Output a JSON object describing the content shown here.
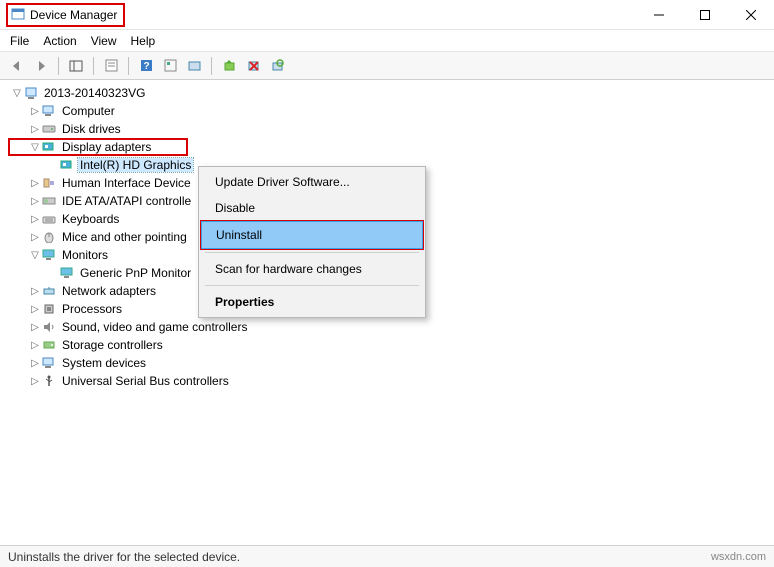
{
  "window": {
    "title": "Device Manager"
  },
  "menu": {
    "file": "File",
    "action": "Action",
    "view": "View",
    "help": "Help"
  },
  "tree": {
    "root": "2013-20140323VG",
    "items": [
      {
        "label": "Computer",
        "twisty": "▷"
      },
      {
        "label": "Disk drives",
        "twisty": "▷"
      },
      {
        "label": "Display adapters",
        "twisty": "▽",
        "highlight": true
      },
      {
        "label": "Intel(R) HD Graphics",
        "child": true,
        "selected": true
      },
      {
        "label": "Human Interface Device",
        "twisty": "▷",
        "truncated": true
      },
      {
        "label": "IDE ATA/ATAPI controlle",
        "twisty": "▷",
        "truncated": true
      },
      {
        "label": "Keyboards",
        "twisty": "▷"
      },
      {
        "label": "Mice and other pointing",
        "twisty": "▷",
        "truncated": true
      },
      {
        "label": "Monitors",
        "twisty": "▽"
      },
      {
        "label": "Generic PnP Monitor",
        "child": true
      },
      {
        "label": "Network adapters",
        "twisty": "▷"
      },
      {
        "label": "Processors",
        "twisty": "▷"
      },
      {
        "label": "Sound, video and game controllers",
        "twisty": "▷"
      },
      {
        "label": "Storage controllers",
        "twisty": "▷"
      },
      {
        "label": "System devices",
        "twisty": "▷"
      },
      {
        "label": "Universal Serial Bus controllers",
        "twisty": "▷"
      }
    ]
  },
  "context_menu": {
    "update": "Update Driver Software...",
    "disable": "Disable",
    "uninstall": "Uninstall",
    "scan": "Scan for hardware changes",
    "properties": "Properties"
  },
  "status": {
    "text": "Uninstalls the driver for the selected device.",
    "watermark": "wsxdn.com"
  }
}
